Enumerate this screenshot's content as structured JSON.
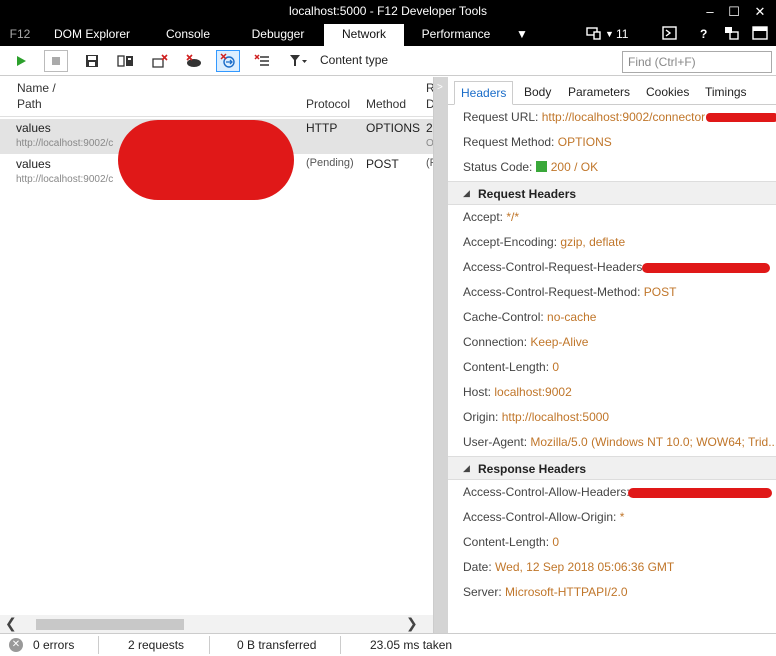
{
  "window": {
    "title": "localhost:5000 - F12 Developer Tools",
    "minimize": "‒",
    "maximize": "☐",
    "close": "✕"
  },
  "tabs": {
    "f12": "F12",
    "items": [
      "DOM Explorer",
      "Console",
      "Debugger",
      "Network",
      "Performance"
    ],
    "active": "Network",
    "more": "▼",
    "emulation_count": "11",
    "console_glyph": "⊳",
    "help": "?"
  },
  "toolbar": {
    "filter_label": "Content type",
    "find_placeholder": "Find (Ctrl+F)"
  },
  "grid": {
    "headers": {
      "name": "Name /",
      "path": "Path",
      "protocol": "Protocol",
      "method": "Method",
      "result_top": "R",
      "result_bottom": "D"
    },
    "rows": [
      {
        "name": "values",
        "path": "http://localhost:9002/c",
        "protocol": "HTTP",
        "method": "OPTIONS",
        "result": "2",
        "result_sub": "O"
      },
      {
        "name": "values",
        "path": "http://localhost:9002/c",
        "protocol": "(Pending)",
        "method": "POST",
        "result": "(F",
        "result_sub": ""
      }
    ],
    "scroll_left": "❮",
    "scroll_right": "❯"
  },
  "details": {
    "tabs": [
      "Headers",
      "Body",
      "Parameters",
      "Cookies",
      "Timings"
    ],
    "active_tab": "Headers",
    "general": [
      {
        "key": "Request URL:",
        "value": "http://localhost:9002/connector"
      },
      {
        "key": "Request Method:",
        "value": "OPTIONS"
      },
      {
        "key": "Status Code:",
        "value": "200 / OK"
      }
    ],
    "request_headers_title": "Request Headers",
    "request_headers": [
      {
        "key": "Accept:",
        "value": "*/*"
      },
      {
        "key": "Accept-Encoding:",
        "value": "gzip, deflate"
      },
      {
        "key": "Access-Control-Request-Headers:",
        "value": ""
      },
      {
        "key": "Access-Control-Request-Method:",
        "value": "POST"
      },
      {
        "key": "Cache-Control:",
        "value": "no-cache"
      },
      {
        "key": "Connection:",
        "value": "Keep-Alive"
      },
      {
        "key": "Content-Length:",
        "value": "0"
      },
      {
        "key": "Host:",
        "value": "localhost:9002"
      },
      {
        "key": "Origin:",
        "value": "http://localhost:5000"
      },
      {
        "key": "User-Agent:",
        "value": "Mozilla/5.0 (Windows NT 10.0; WOW64; Trid..."
      }
    ],
    "response_headers_title": "Response Headers",
    "response_headers": [
      {
        "key": "Access-Control-Allow-Headers:",
        "value": ""
      },
      {
        "key": "Access-Control-Allow-Origin:",
        "value": "*"
      },
      {
        "key": "Content-Length:",
        "value": "0"
      },
      {
        "key": "Date:",
        "value": "Wed, 12 Sep 2018 05:06:36 GMT"
      },
      {
        "key": "Server:",
        "value": "Microsoft-HTTPAPI/2.0"
      }
    ]
  },
  "status": {
    "errors": "0 errors",
    "requests": "2 requests",
    "transferred": "0 B transferred",
    "time": "23.05 ms taken"
  },
  "colors": {
    "accent": "#1a6cc8",
    "value": "#c0762a",
    "status_ok": "#3aa83a",
    "redaction": "#e01818"
  }
}
